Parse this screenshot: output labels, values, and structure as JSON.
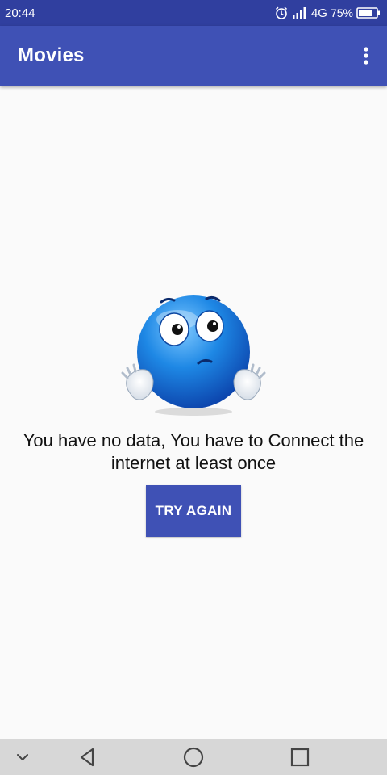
{
  "status_bar": {
    "time": "20:44",
    "network": "4G",
    "battery": "75%",
    "icons": [
      "alarm-icon",
      "signal-icon",
      "battery-icon"
    ]
  },
  "app_bar": {
    "title": "Movies",
    "menu_icon": "more-vert-icon"
  },
  "content": {
    "illustration": "confused-emoji-icon",
    "message": "You have no data, You have to Connect the internet at least once",
    "try_again_label": "TRY AGAIN"
  },
  "nav_bar": {
    "icons": [
      "chevron-down-icon",
      "back-icon",
      "home-icon",
      "recents-icon"
    ]
  },
  "colors": {
    "status_bar": "#303f9f",
    "primary": "#3f51b5",
    "background": "#fafafa",
    "nav_bar": "#d7d7d7"
  }
}
